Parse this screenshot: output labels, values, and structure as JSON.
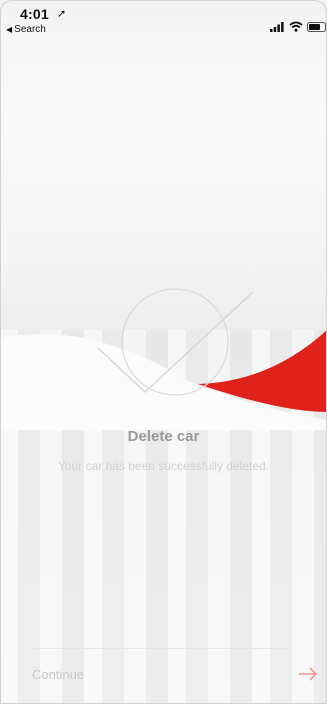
{
  "status_bar": {
    "time": "4:01",
    "location_glyph": "➚",
    "back_label": "Search",
    "back_glyph": "◀"
  },
  "content": {
    "title": "Delete car",
    "message": "Your car has been successfully deleted."
  },
  "footer": {
    "continue_label": "Continue",
    "arrow_icon": "arrow-right-icon"
  },
  "colors": {
    "accent": "#e0221c",
    "title_text": "#9a9a9a",
    "muted_text": "#d0d0d0"
  }
}
